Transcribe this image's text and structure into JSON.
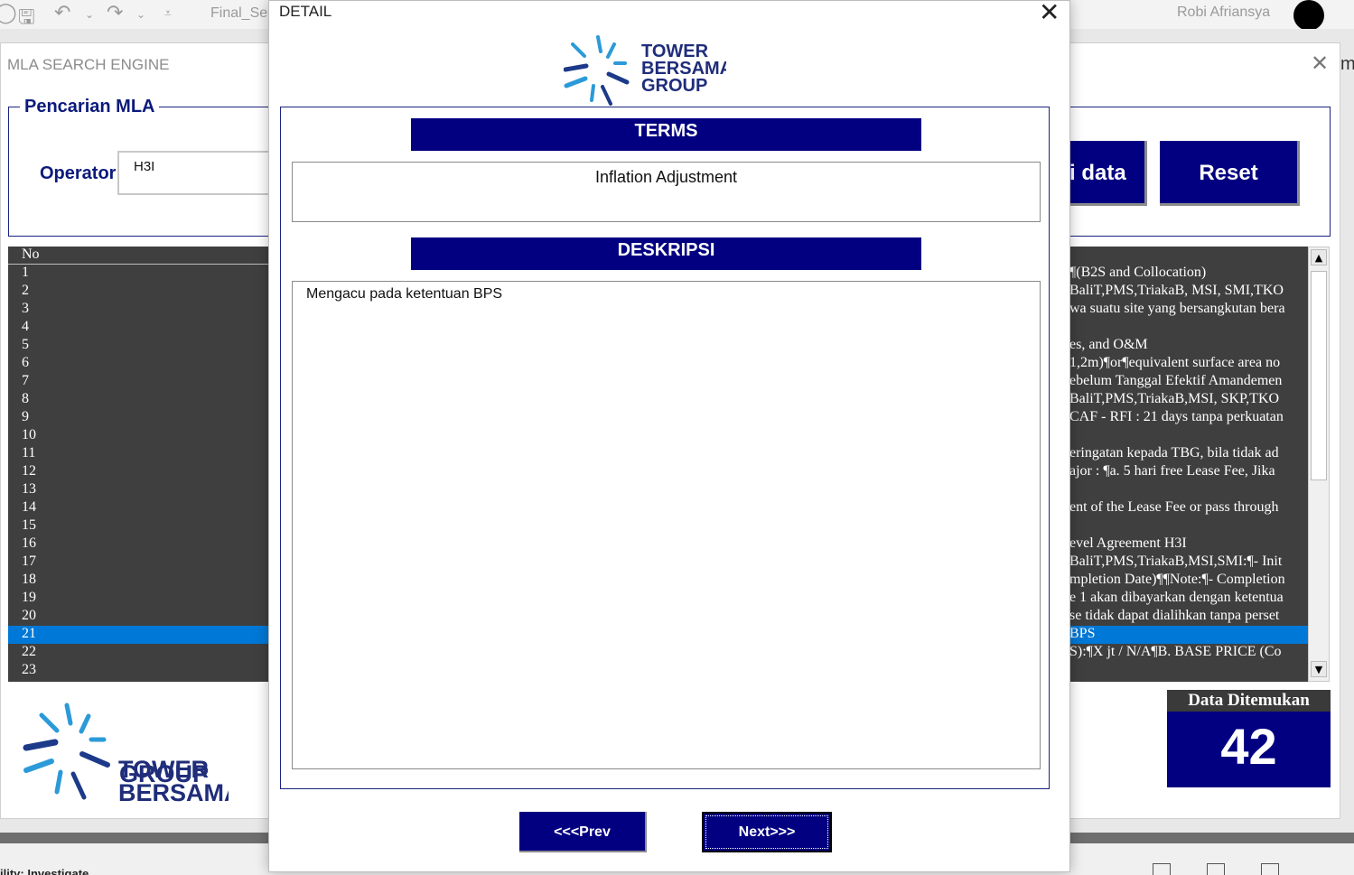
{
  "excel": {
    "file_name": "Final_Se",
    "user_name": "Robi Afriansya",
    "status_text": "ility: Investigate",
    "side_peek": "m"
  },
  "main_window": {
    "title": "MLA SEARCH ENGINE",
    "group_title": "Pencarian MLA",
    "operator_label": "Operator",
    "operator_value": "H3I",
    "partial_button_label": "i data",
    "reset_label": "Reset",
    "list_header": "No",
    "list_numbers": [
      "1",
      "2",
      "3",
      "4",
      "5",
      "6",
      "7",
      "8",
      "9",
      "10",
      "11",
      "12",
      "13",
      "14",
      "15",
      "16",
      "17",
      "18",
      "19",
      "20",
      "21",
      "22",
      "23"
    ],
    "selected_index": 20,
    "list_right_rows": [
      "",
      "¶(B2S and Collocation)",
      "BaliT,PMS,TriakaB, MSI, SMI,TKO",
      "wa suatu site yang bersangkutan bera",
      "",
      "es, and O&M",
      "1,2m)¶or¶equivalent surface area no",
      "ebelum Tanggal Efektif Amandemen",
      "BaliT,PMS,TriakaB,MSI, SKP,TKO",
      "CAF - RFI : 21 days tanpa perkuatan",
      "",
      "eringatan kepada TBG, bila tidak ad",
      "ajor : ¶a.  5 hari free Lease Fee, Jika",
      "",
      "ent of the Lease Fee or pass through",
      "",
      "evel Agreement H3I",
      "BaliT,PMS,TriakaB,MSI,SMI:¶- Init",
      "mpletion Date)¶¶Note:¶- Completion",
      "e 1 akan dibayarkan dengan ketentua",
      "se tidak dapat dialihkan tanpa perset",
      "BPS",
      "S):¶X jt / N/A¶B. BASE PRICE (Co"
    ],
    "data_found_label": "Data Ditemukan",
    "data_found_count": "42"
  },
  "logo": {
    "line1": "TOWER",
    "line2": "BERSAMA",
    "line3": "GROUP"
  },
  "detail": {
    "title": "DETAIL",
    "terms_header": "TERMS",
    "terms_value": "Inflation Adjustment",
    "desc_header": "DESKRIPSI",
    "desc_value": "Mengacu pada ketentuan BPS",
    "prev_label": "<<<Prev",
    "next_label": "Next>>>"
  },
  "colors": {
    "navy": "#020080",
    "logo_text": "#1f2d7a",
    "logo_ray_light": "#2b9ad9",
    "logo_ray_dark": "#1d3a8a",
    "selection": "#0078d7",
    "list_bg": "#3f3f3f"
  }
}
